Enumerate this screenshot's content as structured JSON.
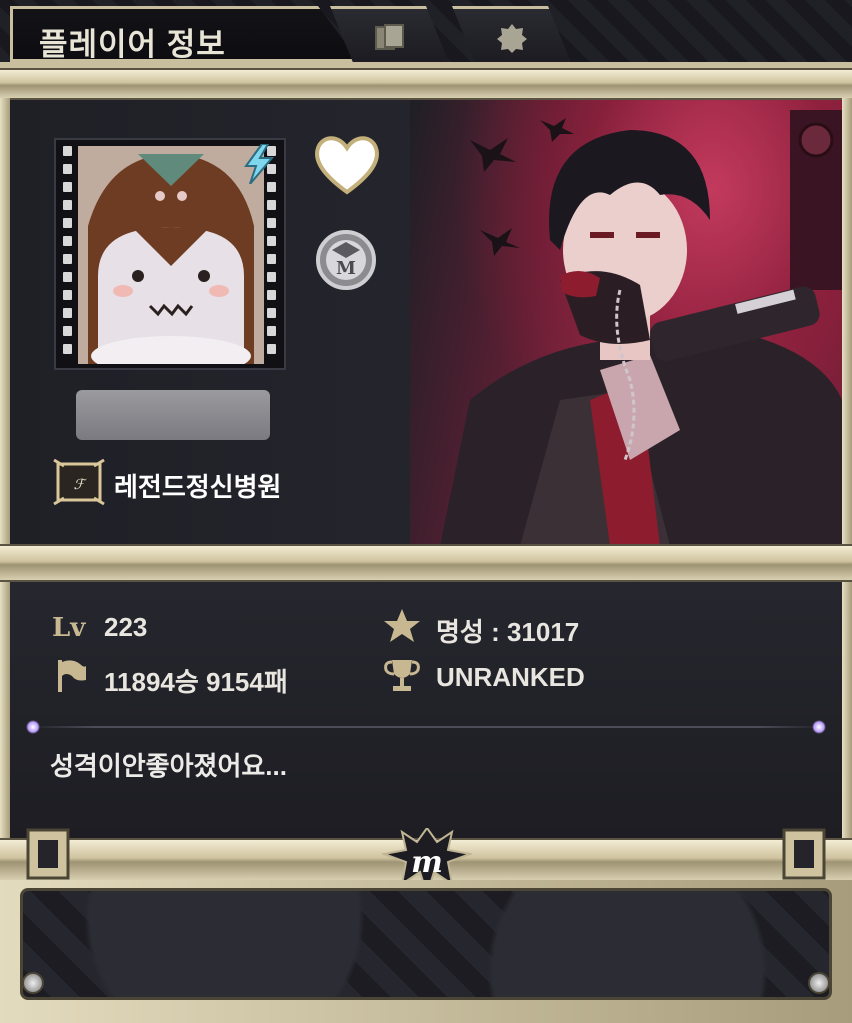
{
  "header": {
    "title": "플레이어 정보",
    "tabs": [
      {
        "icon": "cards-icon"
      },
      {
        "icon": "badge-shield-icon"
      }
    ]
  },
  "profile": {
    "avatar_icon": "vampire-ghost-avatar",
    "badge_icon": "lightning-badge-icon",
    "heart_icon": "heart-icon",
    "medal_icon": "m-medal-icon",
    "nickname_hidden": true,
    "guild": {
      "emblem_icon": "guild-crest-icon",
      "name": "레전드정신병원"
    }
  },
  "stats": {
    "level_label_icon": "level-icon",
    "level": "223",
    "record_icon": "flag-icon",
    "record": "11894승 9154패",
    "fame_icon": "star-icon",
    "fame": "명성 : 31017",
    "rank_icon": "trophy-icon",
    "rank": "UNRANKED"
  },
  "bio": "성격이안좋아졌어요...",
  "colors": {
    "gold": "#c9bf9e",
    "panel": "#1f1f26",
    "art_accent": "#9b2d4b",
    "text": "#e9e6df"
  }
}
